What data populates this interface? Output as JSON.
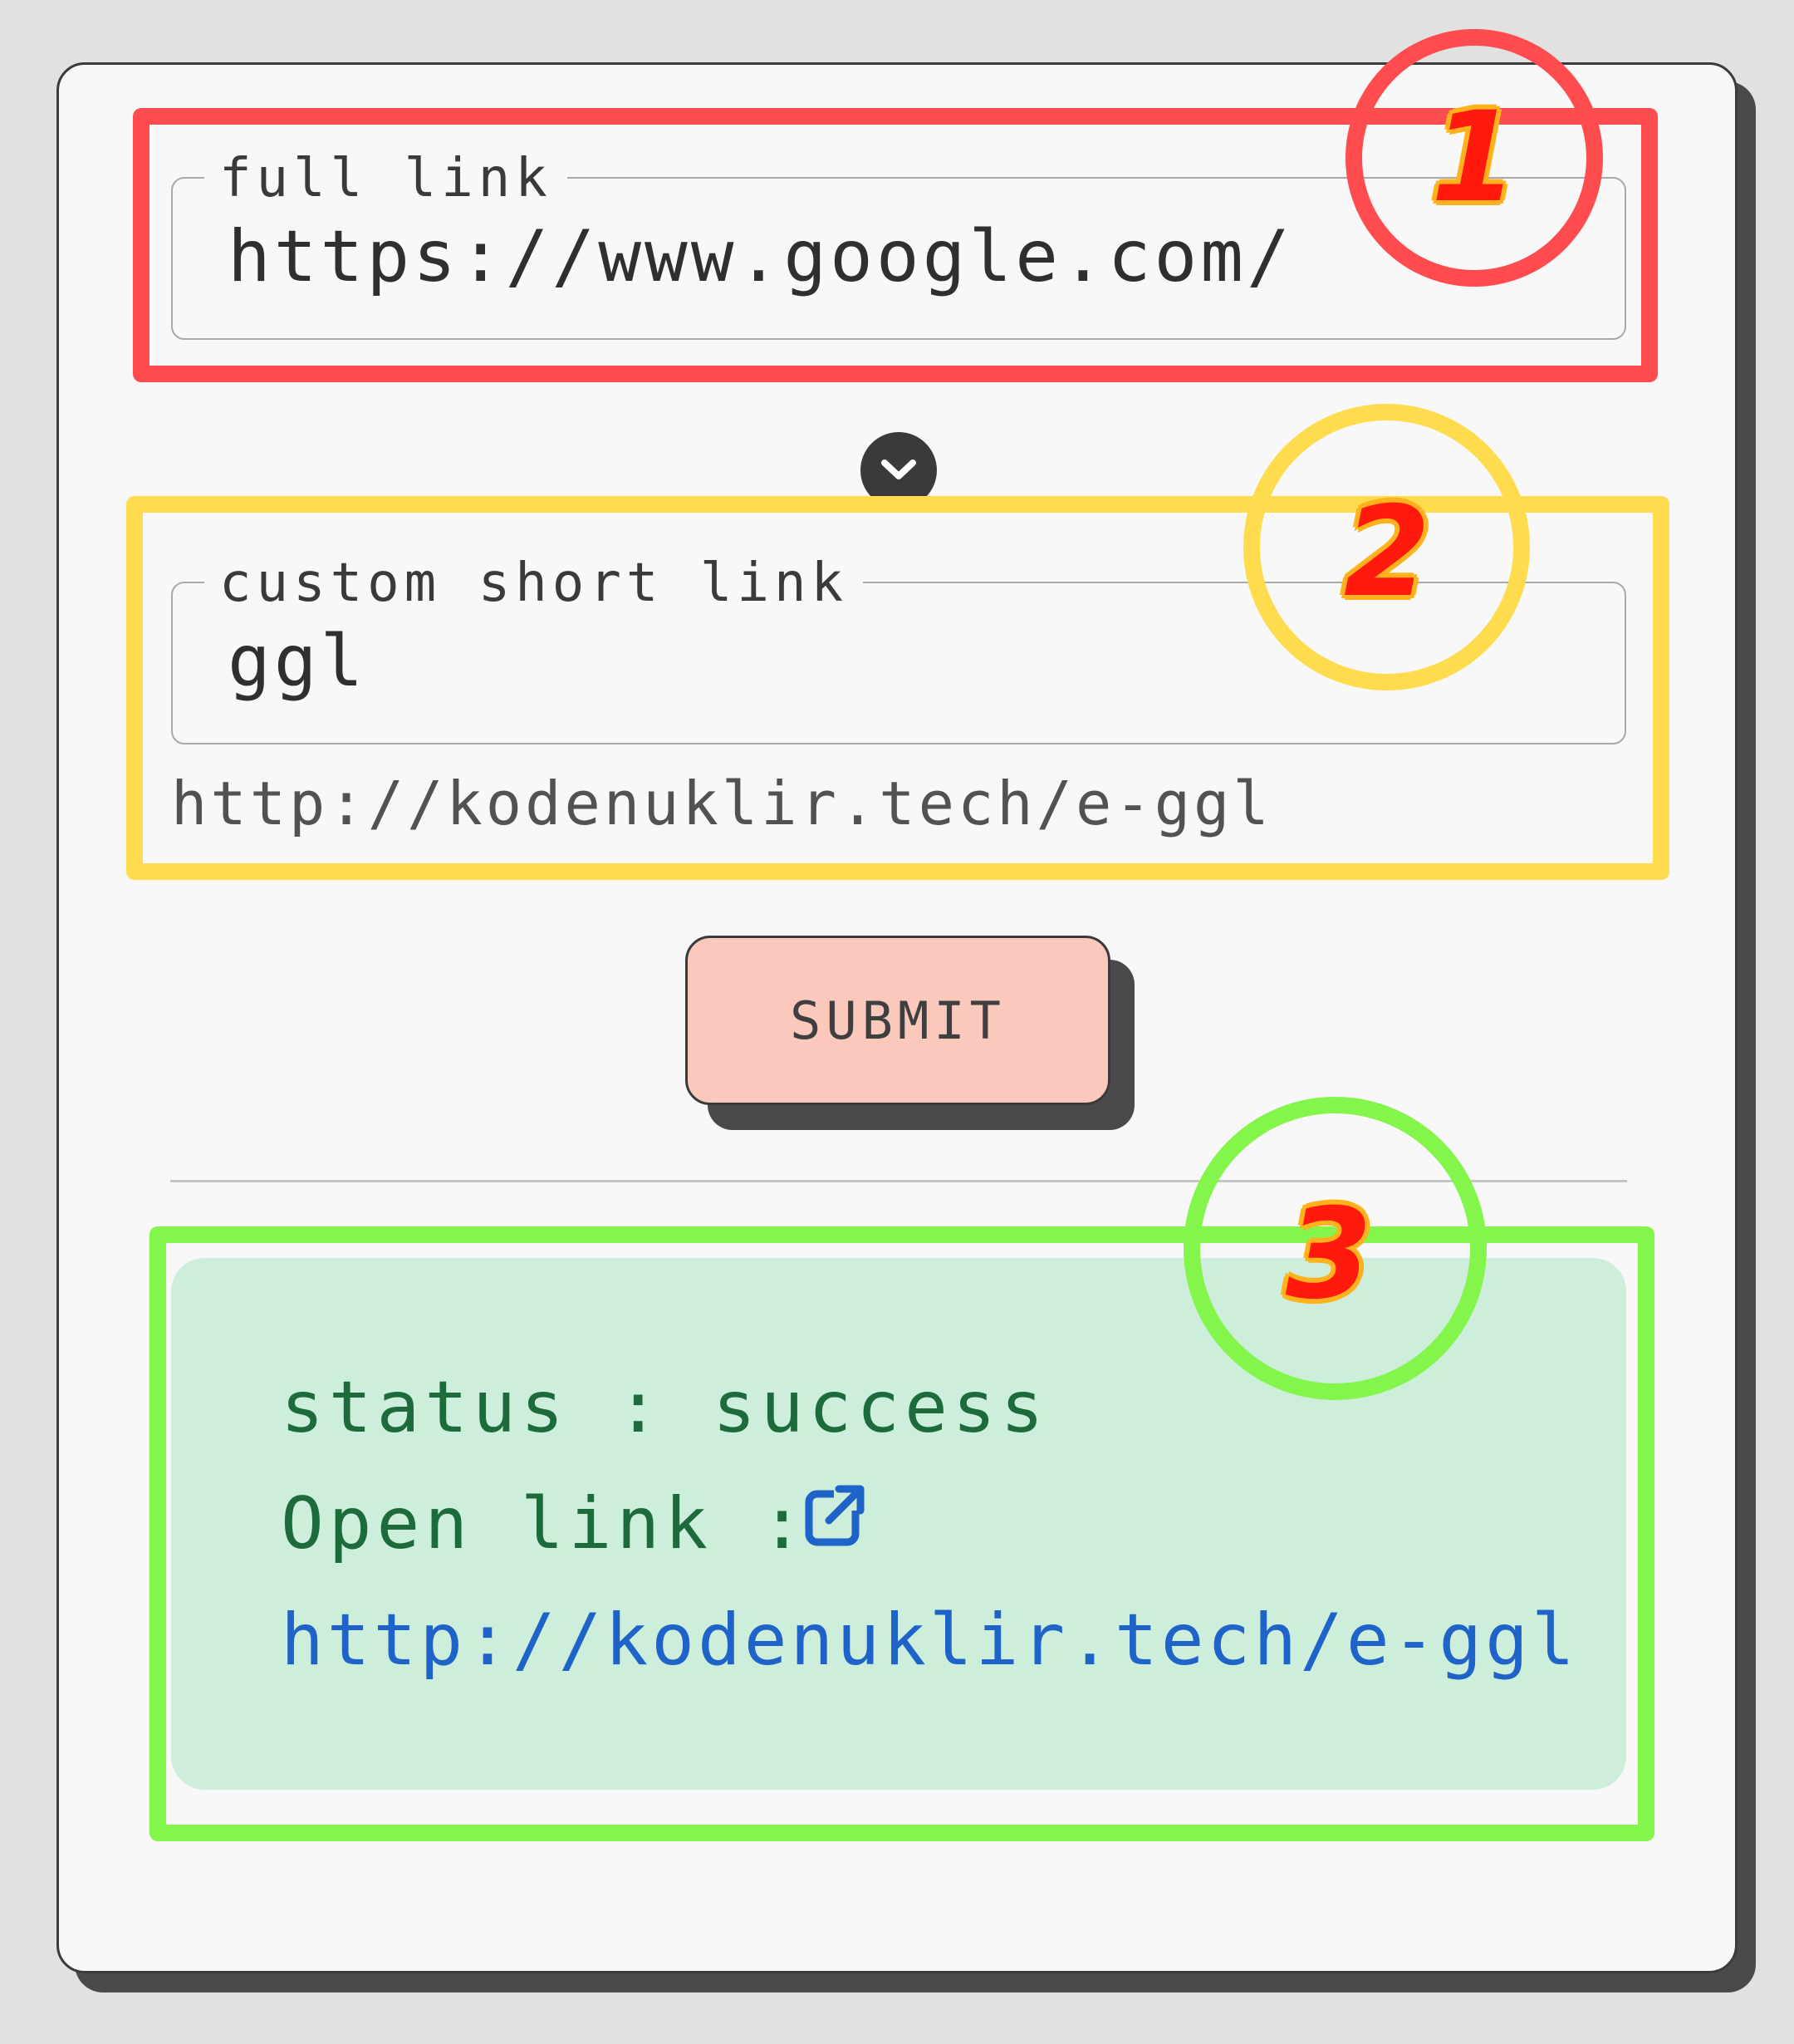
{
  "form": {
    "full_link": {
      "legend": "full link",
      "value": "https://www.google.com/"
    },
    "toggle_icon": "chevron-down-icon",
    "custom_short_link": {
      "legend": "custom short link",
      "value": "ggl",
      "preview": "http://kodenuklir.tech/e-ggl"
    },
    "submit_label": "SUBMIT"
  },
  "result": {
    "status_line": "status : success",
    "open_link_label": "Open link :",
    "open_link_icon": "external-link-icon",
    "short_url": "http://kodenuklir.tech/e-ggl"
  },
  "annotations": [
    {
      "number": "1",
      "color": "#ff4c4f"
    },
    {
      "number": "2",
      "color": "#ffdc4e"
    },
    {
      "number": "3",
      "color": "#84f54b"
    }
  ],
  "colors": {
    "card_bg": "#f8f8f8",
    "submit_bg": "#fbc8bc",
    "result_bg": "#cceedb",
    "status_text": "#1d6a3a",
    "link_text": "#1f63c9"
  }
}
